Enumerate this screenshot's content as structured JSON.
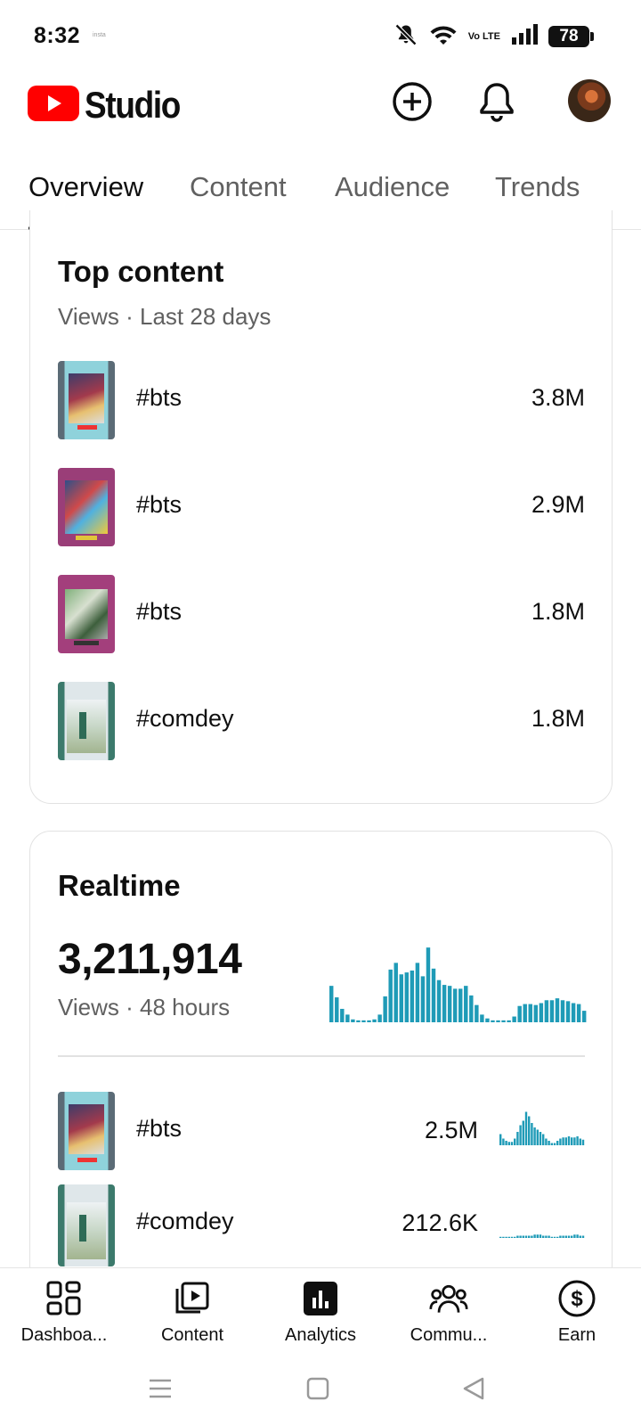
{
  "status_bar": {
    "time": "8:32",
    "mini_text": "insta",
    "volte": "Vo LTE",
    "battery": "78"
  },
  "header": {
    "app_name": "Studio"
  },
  "tabs": [
    {
      "label": "Overview",
      "active": true
    },
    {
      "label": "Content",
      "active": false
    },
    {
      "label": "Audience",
      "active": false
    },
    {
      "label": "Trends",
      "active": false
    }
  ],
  "top_content": {
    "title": "Top content",
    "metric": "Views",
    "period": "Last 28 days",
    "items": [
      {
        "title": "#bts",
        "value": "3.8M"
      },
      {
        "title": "#bts",
        "value": "2.9M"
      },
      {
        "title": "#bts",
        "value": "1.8M"
      },
      {
        "title": "#comdey",
        "value": "1.8M"
      }
    ]
  },
  "realtime": {
    "title": "Realtime",
    "total_views": "3,211,914",
    "metric": "Views",
    "period": "48 hours",
    "accent_color": "#1f9bb7",
    "bars": [
      38,
      26,
      14,
      8,
      3,
      2,
      2,
      2,
      3,
      8,
      27,
      55,
      62,
      50,
      52,
      54,
      62,
      48,
      78,
      56,
      44,
      39,
      38,
      35,
      35,
      38,
      28,
      18,
      8,
      4,
      2,
      2,
      2,
      2,
      6,
      17,
      19,
      19,
      18,
      20,
      23,
      23,
      25,
      23,
      22,
      20,
      19,
      12
    ],
    "items": [
      {
        "title": "#bts",
        "value": "2.5M",
        "bars": [
          10,
          6,
          4,
          3,
          3,
          6,
          12,
          18,
          22,
          30,
          26,
          20,
          16,
          14,
          12,
          10,
          6,
          4,
          2,
          2,
          4,
          6,
          7,
          7,
          8,
          7,
          7,
          8,
          6,
          5
        ]
      },
      {
        "title": "#comdey",
        "value": "212.6K",
        "bars": [
          1,
          1,
          1,
          1,
          1,
          1,
          2,
          2,
          2,
          2,
          2,
          2,
          3,
          3,
          3,
          2,
          2,
          2,
          1,
          1,
          1,
          2,
          2,
          2,
          2,
          2,
          3,
          3,
          2,
          2
        ]
      }
    ]
  },
  "bottom_nav": [
    {
      "label": "Dashboa...",
      "icon": "dashboard-icon",
      "active": false
    },
    {
      "label": "Content",
      "icon": "content-icon",
      "active": false
    },
    {
      "label": "Analytics",
      "icon": "analytics-icon",
      "active": true
    },
    {
      "label": "Commu...",
      "icon": "community-icon",
      "active": false
    },
    {
      "label": "Earn",
      "icon": "earn-icon",
      "active": false
    }
  ],
  "colors": {
    "brand_red": "#ff0000",
    "text": "#0f0f0f",
    "secondary_text": "#606060",
    "chart": "#1f9bb7"
  }
}
